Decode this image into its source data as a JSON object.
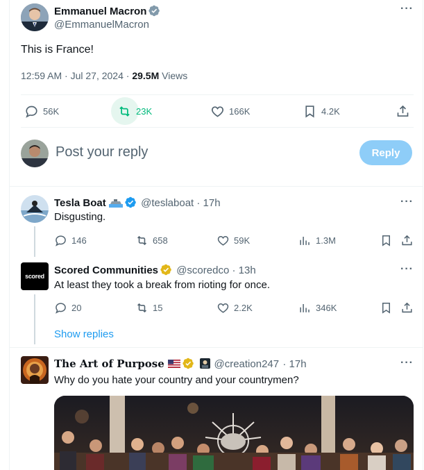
{
  "main_tweet": {
    "name": "Emmanuel Macron",
    "handle": "@EmmanuelMacron",
    "text": "This is France!",
    "timestamp": "12:59 AM · Jul 27, 2024 ·",
    "views_count": "29.5M",
    "views_label": "Views",
    "replies": "56K",
    "reposts": "23K",
    "likes": "166K",
    "bookmarks": "4.2K"
  },
  "composer": {
    "placeholder": "Post your reply",
    "button": "Reply"
  },
  "replies": [
    {
      "name": "Tesla Boat",
      "handle": "@teslaboat",
      "time": "· 17h",
      "text": "Disgusting.",
      "replies": "146",
      "reposts": "658",
      "likes": "59K",
      "views": "1.3M"
    },
    {
      "name": "Scored Communities",
      "handle": "@scoredco",
      "time": "· 13h",
      "avatar_text": "scored",
      "text": "At least they took a break from rioting for once.",
      "replies": "20",
      "reposts": "15",
      "likes": "2.2K",
      "views": "346K"
    },
    {
      "name": "The Art of Purpose",
      "handle": "@creation247",
      "time": "· 17h",
      "text": "Why do you hate your country and your countrymen?"
    }
  ],
  "show_replies": "Show replies",
  "colors": {
    "blue": "#1d9bf0",
    "gold": "#e2b719",
    "repost_green": "#00ba7c",
    "muted": "#536471",
    "reply_button": "#8ecdf8"
  }
}
